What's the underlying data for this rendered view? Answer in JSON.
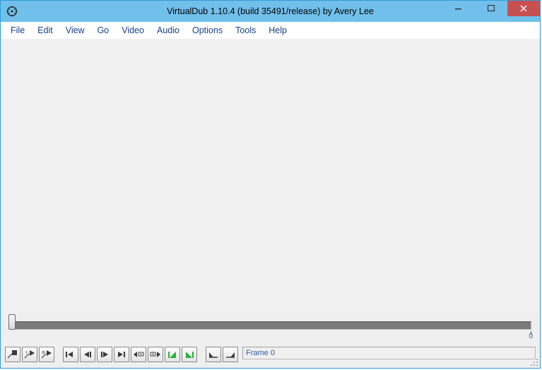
{
  "window": {
    "title": "VirtualDub 1.10.4 (build 35491/release) by Avery Lee"
  },
  "menu": {
    "items": [
      "File",
      "Edit",
      "View",
      "Go",
      "Video",
      "Audio",
      "Options",
      "Tools",
      "Help"
    ]
  },
  "timeline": {
    "end_tick_label": "0"
  },
  "toolbar": {
    "buttons": [
      "stop-button",
      "play-input-button",
      "play-output-button",
      "go-start-button",
      "step-back-button",
      "step-forward-button",
      "go-end-button",
      "prev-keyframe-button",
      "next-keyframe-button",
      "prev-scene-button",
      "next-scene-button",
      "mark-in-button",
      "mark-out-button"
    ]
  },
  "status": {
    "frame_label": "Frame 0"
  }
}
